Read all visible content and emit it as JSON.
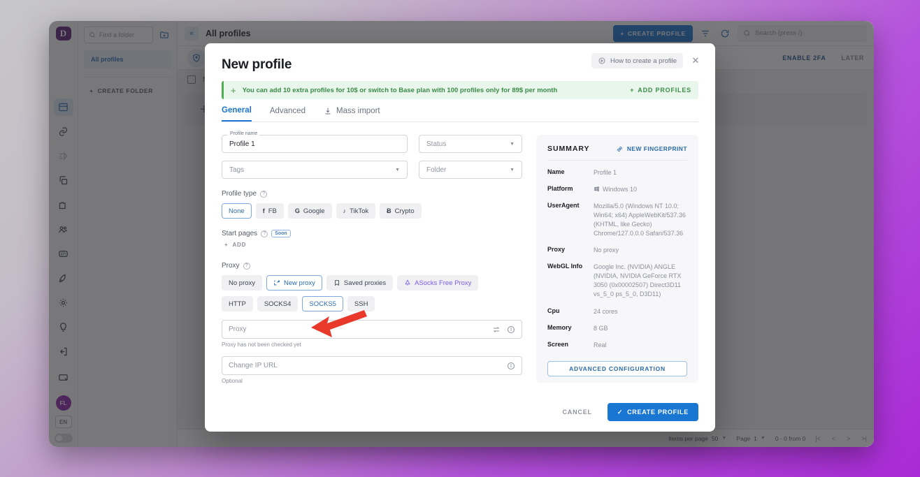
{
  "app": {
    "logo_letter": "D",
    "sidebar_icons": [
      {
        "name": "browser-icon",
        "active": true
      },
      {
        "name": "link-icon",
        "active": false
      },
      {
        "name": "automation-icon",
        "active": false
      },
      {
        "name": "copy-icon",
        "active": false
      },
      {
        "name": "extension-icon",
        "active": false
      },
      {
        "name": "team-icon",
        "active": false
      },
      {
        "name": "api-icon",
        "active": false
      },
      {
        "name": "rocket-icon",
        "active": false
      },
      {
        "name": "gear-icon",
        "active": false
      },
      {
        "name": "bulb-icon",
        "active": false
      },
      {
        "name": "logout-icon",
        "active": false
      }
    ],
    "folders": {
      "search_placeholder": "Find a folder",
      "all_profiles": "All profiles",
      "create_folder": "CREATE FOLDER"
    },
    "topbar": {
      "collapse": "«",
      "title": "All profiles",
      "create_profile": "CREATE PROFILE",
      "search_placeholder": "Search (press /)"
    },
    "twofa": {
      "enable": "ENABLE 2FA",
      "later": "LATER"
    },
    "table": {
      "name_col": "Name"
    },
    "pagination": {
      "items_per_page_label": "Items per page",
      "items_per_page_value": "50",
      "page_label": "Page",
      "page_value": "1",
      "range": "0 - 0 from 0"
    }
  },
  "modal": {
    "title": "New profile",
    "how_to": "How to create a profile",
    "close": "✕",
    "promo": {
      "text": "You can add 10 extra profiles for 10$ or switch to Base plan with 100 profiles only for 89$ per month",
      "add_label": "ADD PROFILES"
    },
    "tabs": [
      {
        "label": "General",
        "active": true
      },
      {
        "label": "Advanced",
        "active": false
      },
      {
        "label": "Mass import",
        "active": false,
        "icon": "import-icon"
      }
    ],
    "fields": {
      "profile_name_legend": "Profile name",
      "profile_name_value": "Profile 1",
      "status_placeholder": "Status",
      "tags_placeholder": "Tags",
      "folder_placeholder": "Folder"
    },
    "profile_type": {
      "label": "Profile type",
      "options": [
        {
          "label": "None",
          "icon": "",
          "selected": true
        },
        {
          "label": "FB",
          "icon": "f",
          "selected": false
        },
        {
          "label": "Google",
          "icon": "G",
          "selected": false
        },
        {
          "label": "TikTok",
          "icon": "♪",
          "selected": false
        },
        {
          "label": "Crypto",
          "icon": "Ƀ",
          "selected": false
        }
      ]
    },
    "start_pages": {
      "label": "Start pages",
      "badge": "Soon",
      "add_label": "ADD"
    },
    "proxy": {
      "label": "Proxy",
      "modes": [
        {
          "label": "No proxy",
          "selected": false,
          "icon": ""
        },
        {
          "label": "New proxy",
          "selected": true,
          "icon": "new-proxy-icon"
        },
        {
          "label": "Saved proxies",
          "selected": false,
          "icon": "bookmark-icon"
        },
        {
          "label": "ASocks Free Proxy",
          "selected": false,
          "icon": "asocks-icon",
          "accent": true
        }
      ],
      "protocols": [
        {
          "label": "HTTP",
          "selected": false
        },
        {
          "label": "SOCKS4",
          "selected": false
        },
        {
          "label": "SOCKS5",
          "selected": true
        },
        {
          "label": "SSH",
          "selected": false
        }
      ],
      "input_placeholder": "Proxy",
      "status_hint": "Proxy has not been checked yet",
      "change_ip_placeholder": "Change IP URL",
      "change_ip_hint": "Optional"
    },
    "summary": {
      "title": "SUMMARY",
      "new_fingerprint": "NEW FINGERPRINT",
      "rows": [
        {
          "key": "Name",
          "value": "Profile 1"
        },
        {
          "key": "Platform",
          "value": "Windows 10",
          "icon": "windows-icon"
        },
        {
          "key": "UserAgent",
          "value": "Mozilla/5.0 (Windows NT 10.0; Win64; x64) AppleWebKit/537.36 (KHTML, like Gecko) Chrome/127.0.0.0 Safari/537.36"
        },
        {
          "key": "Proxy",
          "value": "No proxy"
        },
        {
          "key": "WebGL Info",
          "value": "Google Inc. (NVIDIA) ANGLE (NVIDIA, NVIDIA GeForce RTX 3050 (0x00002507) Direct3D11 vs_5_0 ps_5_0, D3D11)"
        },
        {
          "key": "Cpu",
          "value": "24 cores"
        },
        {
          "key": "Memory",
          "value": "8 GB"
        },
        {
          "key": "Screen",
          "value": "Real"
        }
      ],
      "advanced_btn": "ADVANCED CONFIGURATION"
    },
    "footer": {
      "cancel": "CANCEL",
      "create": "CREATE PROFILE"
    }
  },
  "annotation": {
    "arrow_color": "#e8392b"
  }
}
